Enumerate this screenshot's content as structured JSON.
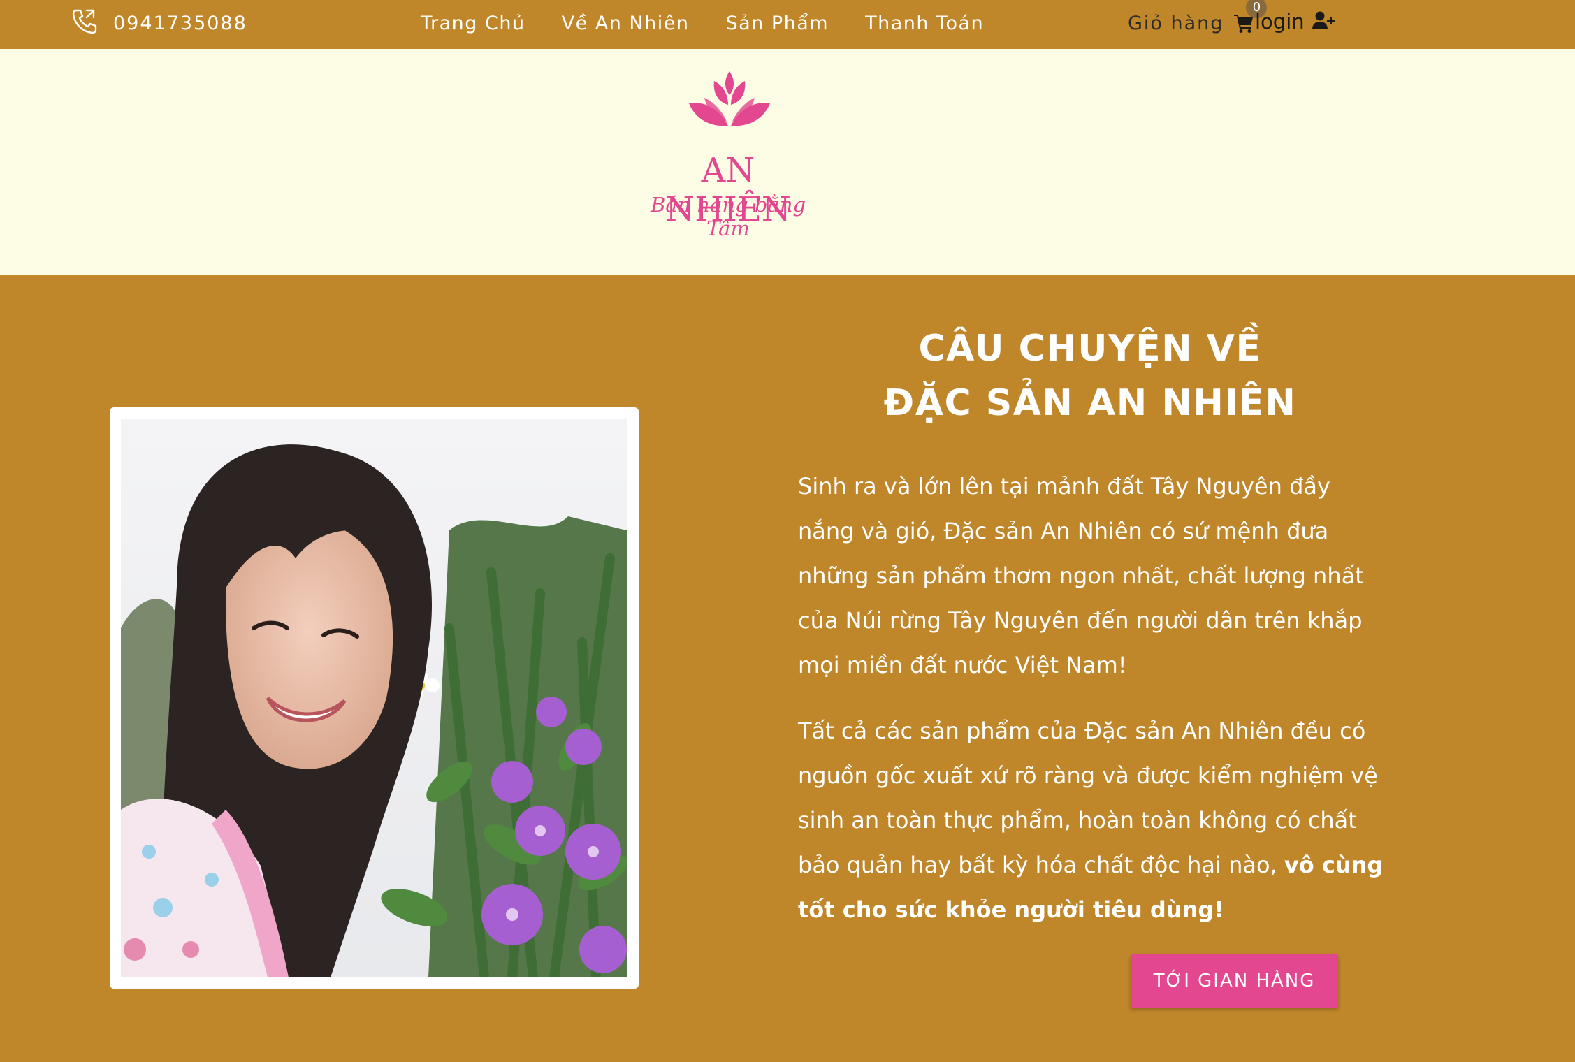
{
  "topbar": {
    "phone_icon": "phone-incoming-icon",
    "phone": "0941735088",
    "nav": [
      "Trang Chủ",
      "Về An Nhiên",
      "Sản Phẩm",
      "Thanh Toán"
    ],
    "cart_label": "Giỏ hàng",
    "cart_icon": "shopping-cart-icon",
    "cart_count": "0",
    "login_label": "login",
    "login_icon": "user-plus-icon"
  },
  "logo": {
    "name": "AN NHIÊN",
    "tagline": "Bán hàng bằng Tâm",
    "color": "#e2478f"
  },
  "story": {
    "title_line1": "CÂU CHUYỆN VỀ",
    "title_line2": "ĐẶC SẢN AN NHIÊN",
    "paragraph1": "Sinh ra và lớn lên tại mảnh đất Tây Nguyên đầy nắng và gió, Đặc sản An Nhiên có sứ mệnh đưa những sản phẩm thơm ngon nhất, chất lượng nhất của Núi rừng Tây Nguyên đến người dân trên khắp mọi miền đất nước Việt Nam!",
    "paragraph2": "Tất cả các sản phẩm của Đặc sản An Nhiên đều có nguồn gốc xuất xứ rõ ràng và được kiểm nghiệm vệ sinh an toàn thực phẩm, hoàn toàn không có chất bảo quản hay bất kỳ hóa chất độc hại nào,",
    "paragraph2_bold": "vô cùng tốt cho sức khỏe người tiêu dùng!",
    "cta_label": "TỚI GIAN HÀNG"
  },
  "colors": {
    "background": "#c0862a",
    "logo_band": "#fdfde6",
    "accent_pink": "#e2478f"
  }
}
